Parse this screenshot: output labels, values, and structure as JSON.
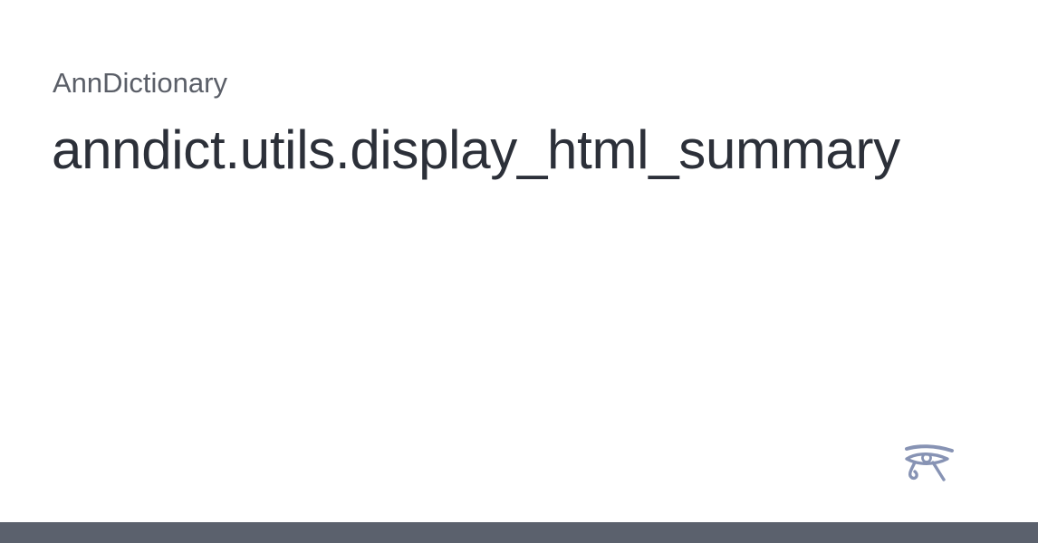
{
  "site": {
    "name": "AnnDictionary"
  },
  "page": {
    "title": "anndict.utils.display_html_summary"
  },
  "logo": {
    "icon": "eye-of-horus-icon",
    "color": "#8793b4"
  },
  "theme": {
    "background": "#ffffff",
    "site_name_color": "#5b5f68",
    "title_color": "#2c3039",
    "footer_color": "#5b616d"
  }
}
